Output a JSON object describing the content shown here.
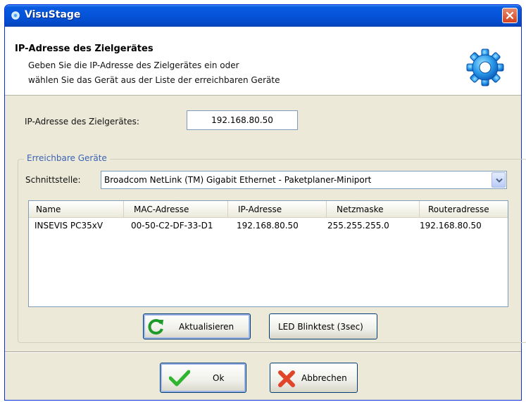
{
  "window": {
    "title": "VisuStage"
  },
  "header": {
    "title": "IP-Adresse des Zielgerätes",
    "line1": "Geben Sie die IP-Adresse des Zielgerätes ein oder",
    "line2": "wählen Sie das Gerät aus der Liste der erreichbaren Geräte"
  },
  "ip_field": {
    "label": "IP-Adresse des Zielgerätes:",
    "value": "192.168.80.50"
  },
  "group": {
    "legend": "Erreichbare Geräte",
    "interface_label": "Schnittstelle:",
    "interface_value": "Broadcom NetLink (TM) Gigabit Ethernet - Paketplaner-Miniport"
  },
  "devices": {
    "columns": [
      "Name",
      "MAC-Adresse",
      "IP-Adresse",
      "Netzmaske",
      "Routeradresse"
    ],
    "rows": [
      [
        "INSEVIS PC35xV",
        "00-50-C2-DF-33-D1",
        "192.168.80.50",
        "255.255.255.0",
        "192.168.80.50"
      ]
    ]
  },
  "buttons": {
    "refresh": "Aktualisieren",
    "led_test": "LED Blinktest (3sec)",
    "ok": "Ok",
    "cancel": "Abbrechen"
  },
  "colors": {
    "titlebar": "#0453d9",
    "dialog_bg": "#ece9d8",
    "legend_text": "#3a63b6",
    "close_button": "#d3421e"
  },
  "icons": [
    "app-icon",
    "close-icon",
    "gear-icon",
    "dropdown-arrow-icon",
    "refresh-icon",
    "checkmark-icon",
    "cross-icon"
  ]
}
